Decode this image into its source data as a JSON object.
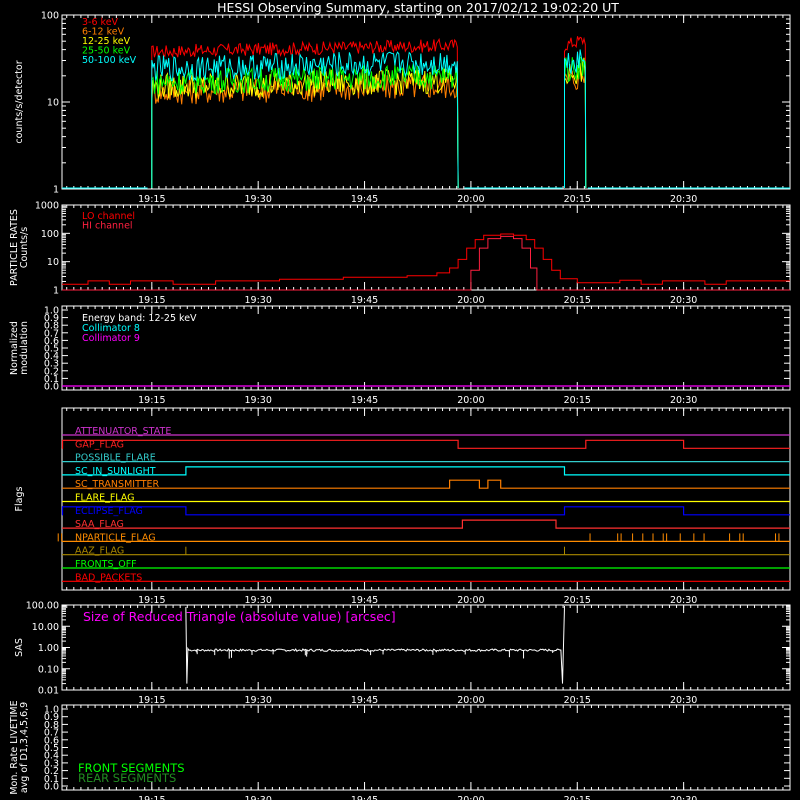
{
  "title": "HESSI Observing Summary, starting on 2017/02/12 19:02:20 UT",
  "time_ticks": [
    "19:15",
    "19:30",
    "19:45",
    "20:00",
    "20:15",
    "20:30"
  ],
  "colors": {
    "background": "#000000",
    "axes": "#ffffff",
    "e3_6": "#ff0000",
    "e6_12": "#ff7f00",
    "e12_25": "#ffff00",
    "e25_50": "#00ff00",
    "e50_100": "#00ffff",
    "lo_channel": "#ff0000",
    "hi_channel": "#ff2040",
    "collimator8": "#00ffff",
    "collimator9": "#ff00ff",
    "srt": "#ff00ff",
    "front": "#00ff00",
    "rear": "#228b22"
  },
  "chart_data": [
    {
      "type": "line",
      "name": "count_rates",
      "ylabel": "counts/s/detector",
      "yscale": "log",
      "ylim": [
        1,
        100
      ],
      "ytick_labels": [
        "1",
        "10",
        "100"
      ],
      "series": [
        {
          "name": "3-6 keV",
          "color": "#ff0000",
          "segments": [
            [
              19.25,
              19.97,
              38
            ],
            [
              20.22,
              20.27,
              45
            ]
          ]
        },
        {
          "name": "6-12 keV",
          "color": "#ff7f00",
          "segments": [
            [
              19.25,
              19.97,
              13
            ],
            [
              20.22,
              20.27,
              17
            ]
          ]
        },
        {
          "name": "12-25 keV",
          "color": "#ffff00",
          "segments": [
            [
              19.25,
              19.97,
              15
            ],
            [
              20.22,
              20.27,
              20
            ]
          ]
        },
        {
          "name": "25-50 keV",
          "color": "#00ff00",
          "segments": [
            [
              19.25,
              19.97,
              17
            ],
            [
              20.22,
              20.27,
              23
            ]
          ]
        },
        {
          "name": "50-100 keV",
          "color": "#00ffff",
          "segments": [
            [
              19.25,
              19.97,
              24
            ],
            [
              20.22,
              20.27,
              28
            ]
          ]
        }
      ]
    },
    {
      "type": "line",
      "name": "particle_rates",
      "ylabel": "PARTICLE RATES\nCounts/s",
      "yscale": "log",
      "ylim": [
        1,
        1000
      ],
      "ytick_labels": [
        "1",
        "10",
        "100",
        "1000"
      ],
      "series": [
        {
          "name": "LO channel",
          "color": "#ff0000"
        },
        {
          "name": "HI channel",
          "color": "#ff2040"
        }
      ]
    },
    {
      "type": "line",
      "name": "modulation",
      "ylabel": "Normalized\nmodulation",
      "ylim": [
        0,
        1
      ],
      "ytick_labels": [
        "0.0",
        "0.1",
        "0.2",
        "0.3",
        "0.4",
        "0.5",
        "0.6",
        "0.7",
        "0.8",
        "0.9",
        "1.0"
      ],
      "legend": [
        "Energy band: 12-25 keV",
        "Collimator 8",
        "Collimator 9"
      ]
    },
    {
      "type": "line",
      "name": "flags",
      "ylabel": "Flags",
      "flags": [
        {
          "name": "ATTENUATOR_STATE",
          "color": "#cc33cc",
          "high_intervals": []
        },
        {
          "name": "GAP_FLAG",
          "color": "#ff2020",
          "high_intervals": [
            [
              19.04,
              19.97
            ],
            [
              20.27,
              20.5
            ]
          ]
        },
        {
          "name": "POSSIBLE_FLARE",
          "color": "#33cccc",
          "high_intervals": []
        },
        {
          "name": "SC_IN_SUNLIGHT",
          "color": "#00ffff",
          "high_intervals": [
            [
              19.33,
              20.22
            ]
          ]
        },
        {
          "name": "SC_TRANSMITTER",
          "color": "#ff7f00",
          "high_intervals": [
            [
              19.95,
              20.02
            ],
            [
              20.04,
              20.07
            ]
          ]
        },
        {
          "name": "FLARE_FLAG",
          "color": "#ffff00",
          "high_intervals": []
        },
        {
          "name": "ECLIPSE_FLAG",
          "color": "#0000ff",
          "high_intervals": [
            [
              19.04,
              19.33
            ],
            [
              20.22,
              20.5
            ]
          ]
        },
        {
          "name": "SAA_FLAG",
          "color": "#ff3030",
          "high_intervals": [
            [
              19.98,
              20.2
            ]
          ]
        },
        {
          "name": "NPARTICLE_FLAG",
          "color": "#ff8c00",
          "high_intervals": []
        },
        {
          "name": "AAZ_FLAG",
          "color": "#aa8800",
          "high_intervals": []
        },
        {
          "name": "FRONTS_OFF",
          "color": "#00ff00",
          "high_intervals": []
        },
        {
          "name": "BAD_PACKETS",
          "color": "#ff0000",
          "high_intervals": []
        }
      ]
    },
    {
      "type": "line",
      "name": "sas",
      "ylabel": "SAS",
      "yscale": "log",
      "ylim": [
        0.01,
        100
      ],
      "ytick_labels": [
        "0.01",
        "0.10",
        "1.00",
        "10.00",
        "100.00"
      ],
      "annotation": "Size of Reduced Triangle (absolute value) [arcsec]",
      "series": [
        {
          "name": "",
          "color": "#ffffff",
          "segments": [
            [
              19.33,
              20.22,
              0.75
            ]
          ]
        }
      ]
    },
    {
      "type": "line",
      "name": "livetime",
      "ylabel": "Mon. Rate LIVETIME\navg of D1,3,4,5,6,9",
      "ylim": [
        0,
        1
      ],
      "ytick_labels": [
        "0.0",
        "0.1",
        "0.2",
        "0.3",
        "0.4",
        "0.5",
        "0.6",
        "0.7",
        "0.8",
        "0.9",
        "1.0"
      ],
      "legend": [
        "FRONT SEGMENTS",
        "REAR SEGMENTS"
      ]
    }
  ]
}
